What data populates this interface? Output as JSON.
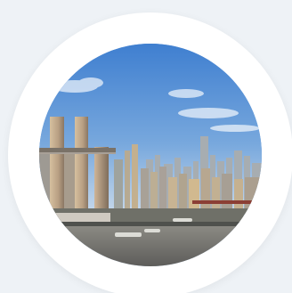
{
  "avatar": {
    "alt": "",
    "scene": "city-skyline-riverside",
    "colors": {
      "background": "#eef2f6",
      "ring": "#ffffff",
      "sky_top": "#3f7fd0",
      "sky_bottom": "#dfe8f1",
      "river": "#6f6e6a",
      "tower": "#bda58a"
    }
  }
}
